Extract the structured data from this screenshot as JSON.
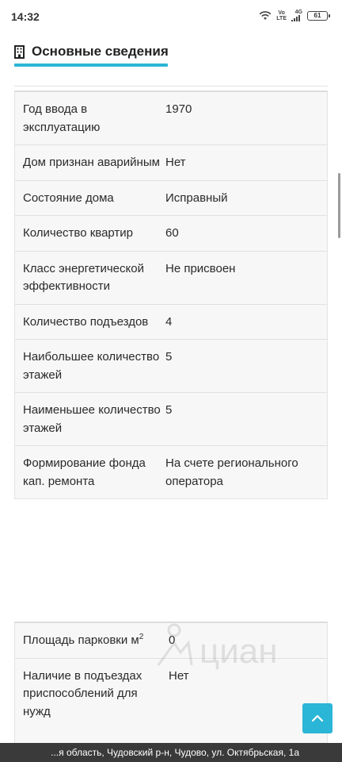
{
  "status_bar": {
    "time": "14:32",
    "network_volte": "Vo\nLTE",
    "network_4g": "4G",
    "battery": "61",
    "icons": [
      "wifi-icon",
      "volte-icon",
      "signal-icon",
      "battery-icon"
    ]
  },
  "section": {
    "title": "Основные сведения",
    "icon": "building-icon",
    "accent_color": "#2bb5d6"
  },
  "table_main": [
    {
      "label": "Год ввода в эксплуатацию",
      "value": "1970"
    },
    {
      "label": "Дом признан аварийным",
      "value": "Нет"
    },
    {
      "label": "Состояние дома",
      "value": "Исправный"
    },
    {
      "label": "Количество квартир",
      "value": "60"
    },
    {
      "label": "Класс энергетической эффективности",
      "value": "Не присвоен"
    },
    {
      "label": "Количество подъездов",
      "value": "4"
    },
    {
      "label": "Наибольшее количество этажей",
      "value": "5"
    },
    {
      "label": "Наименьшее количество этажей",
      "value": "5"
    },
    {
      "label": "Формирование фонда кап. ремонта",
      "value": "На счете регионального оператора"
    }
  ],
  "table_secondary": [
    {
      "label": "Площадь парковки м",
      "label_sup": "2",
      "value": "0"
    },
    {
      "label": "Наличие в подъездах приспособлений для нужд",
      "value": "Нет"
    }
  ],
  "watermark": {
    "text": "циан"
  },
  "bottom_bar": {
    "address": "...я область, Чудовский р-н, Чудово, ул. Октябрьская, 1а"
  },
  "scroll_top_icon": "chevron-up-icon"
}
